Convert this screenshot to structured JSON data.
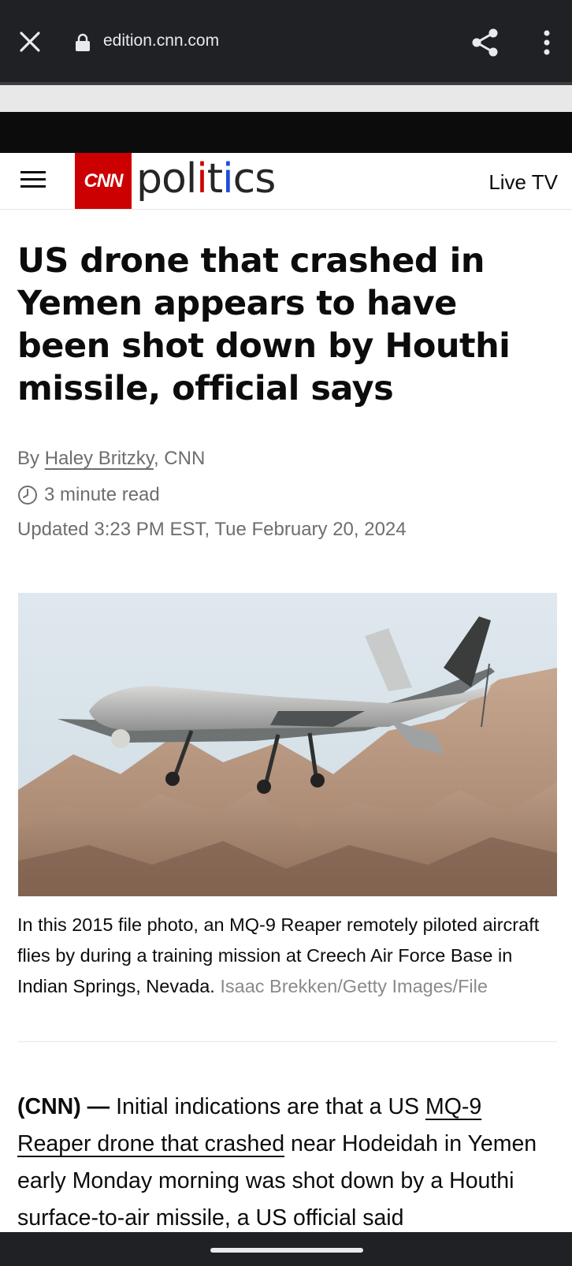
{
  "browser": {
    "url": "edition.cnn.com"
  },
  "site": {
    "logo": "CNN",
    "section": "politics",
    "live_tv": "Live TV",
    "section_colors": {
      "p": "#262626",
      "o": "#262626",
      "l": "#262626",
      "i1": "#cc0000",
      "t": "#262626",
      "i2": "#1d4ed8",
      "c": "#262626",
      "s": "#262626"
    }
  },
  "article": {
    "headline": "US drone that crashed in Yemen appears to have been shot down by Houthi missile, official says",
    "byline_prefix": "By ",
    "author": "Haley Britzky",
    "byline_suffix": ", CNN",
    "read_time": "3 minute read",
    "updated": "Updated 3:23 PM EST, Tue February 20, 2024",
    "caption": "In this 2015 file photo, an MQ-9 Reaper remotely piloted aircraft flies by during a training mission at Creech Air Force Base in Indian Springs, Nevada.",
    "credit": "Isaac Brekken/Getty Images/File",
    "dateline": "(CNN) —",
    "body_1": " Initial indications are that a US ",
    "body_link": "MQ-9 Reaper drone that crashed",
    "body_2": " near Hodeidah in Yemen early Monday morning was shot down by a Houthi surface-to-air missile, a US official said"
  },
  "colors": {
    "brand_red": "#cc0000",
    "browser_chrome": "#202124",
    "meta_text": "#6e6e6e"
  }
}
